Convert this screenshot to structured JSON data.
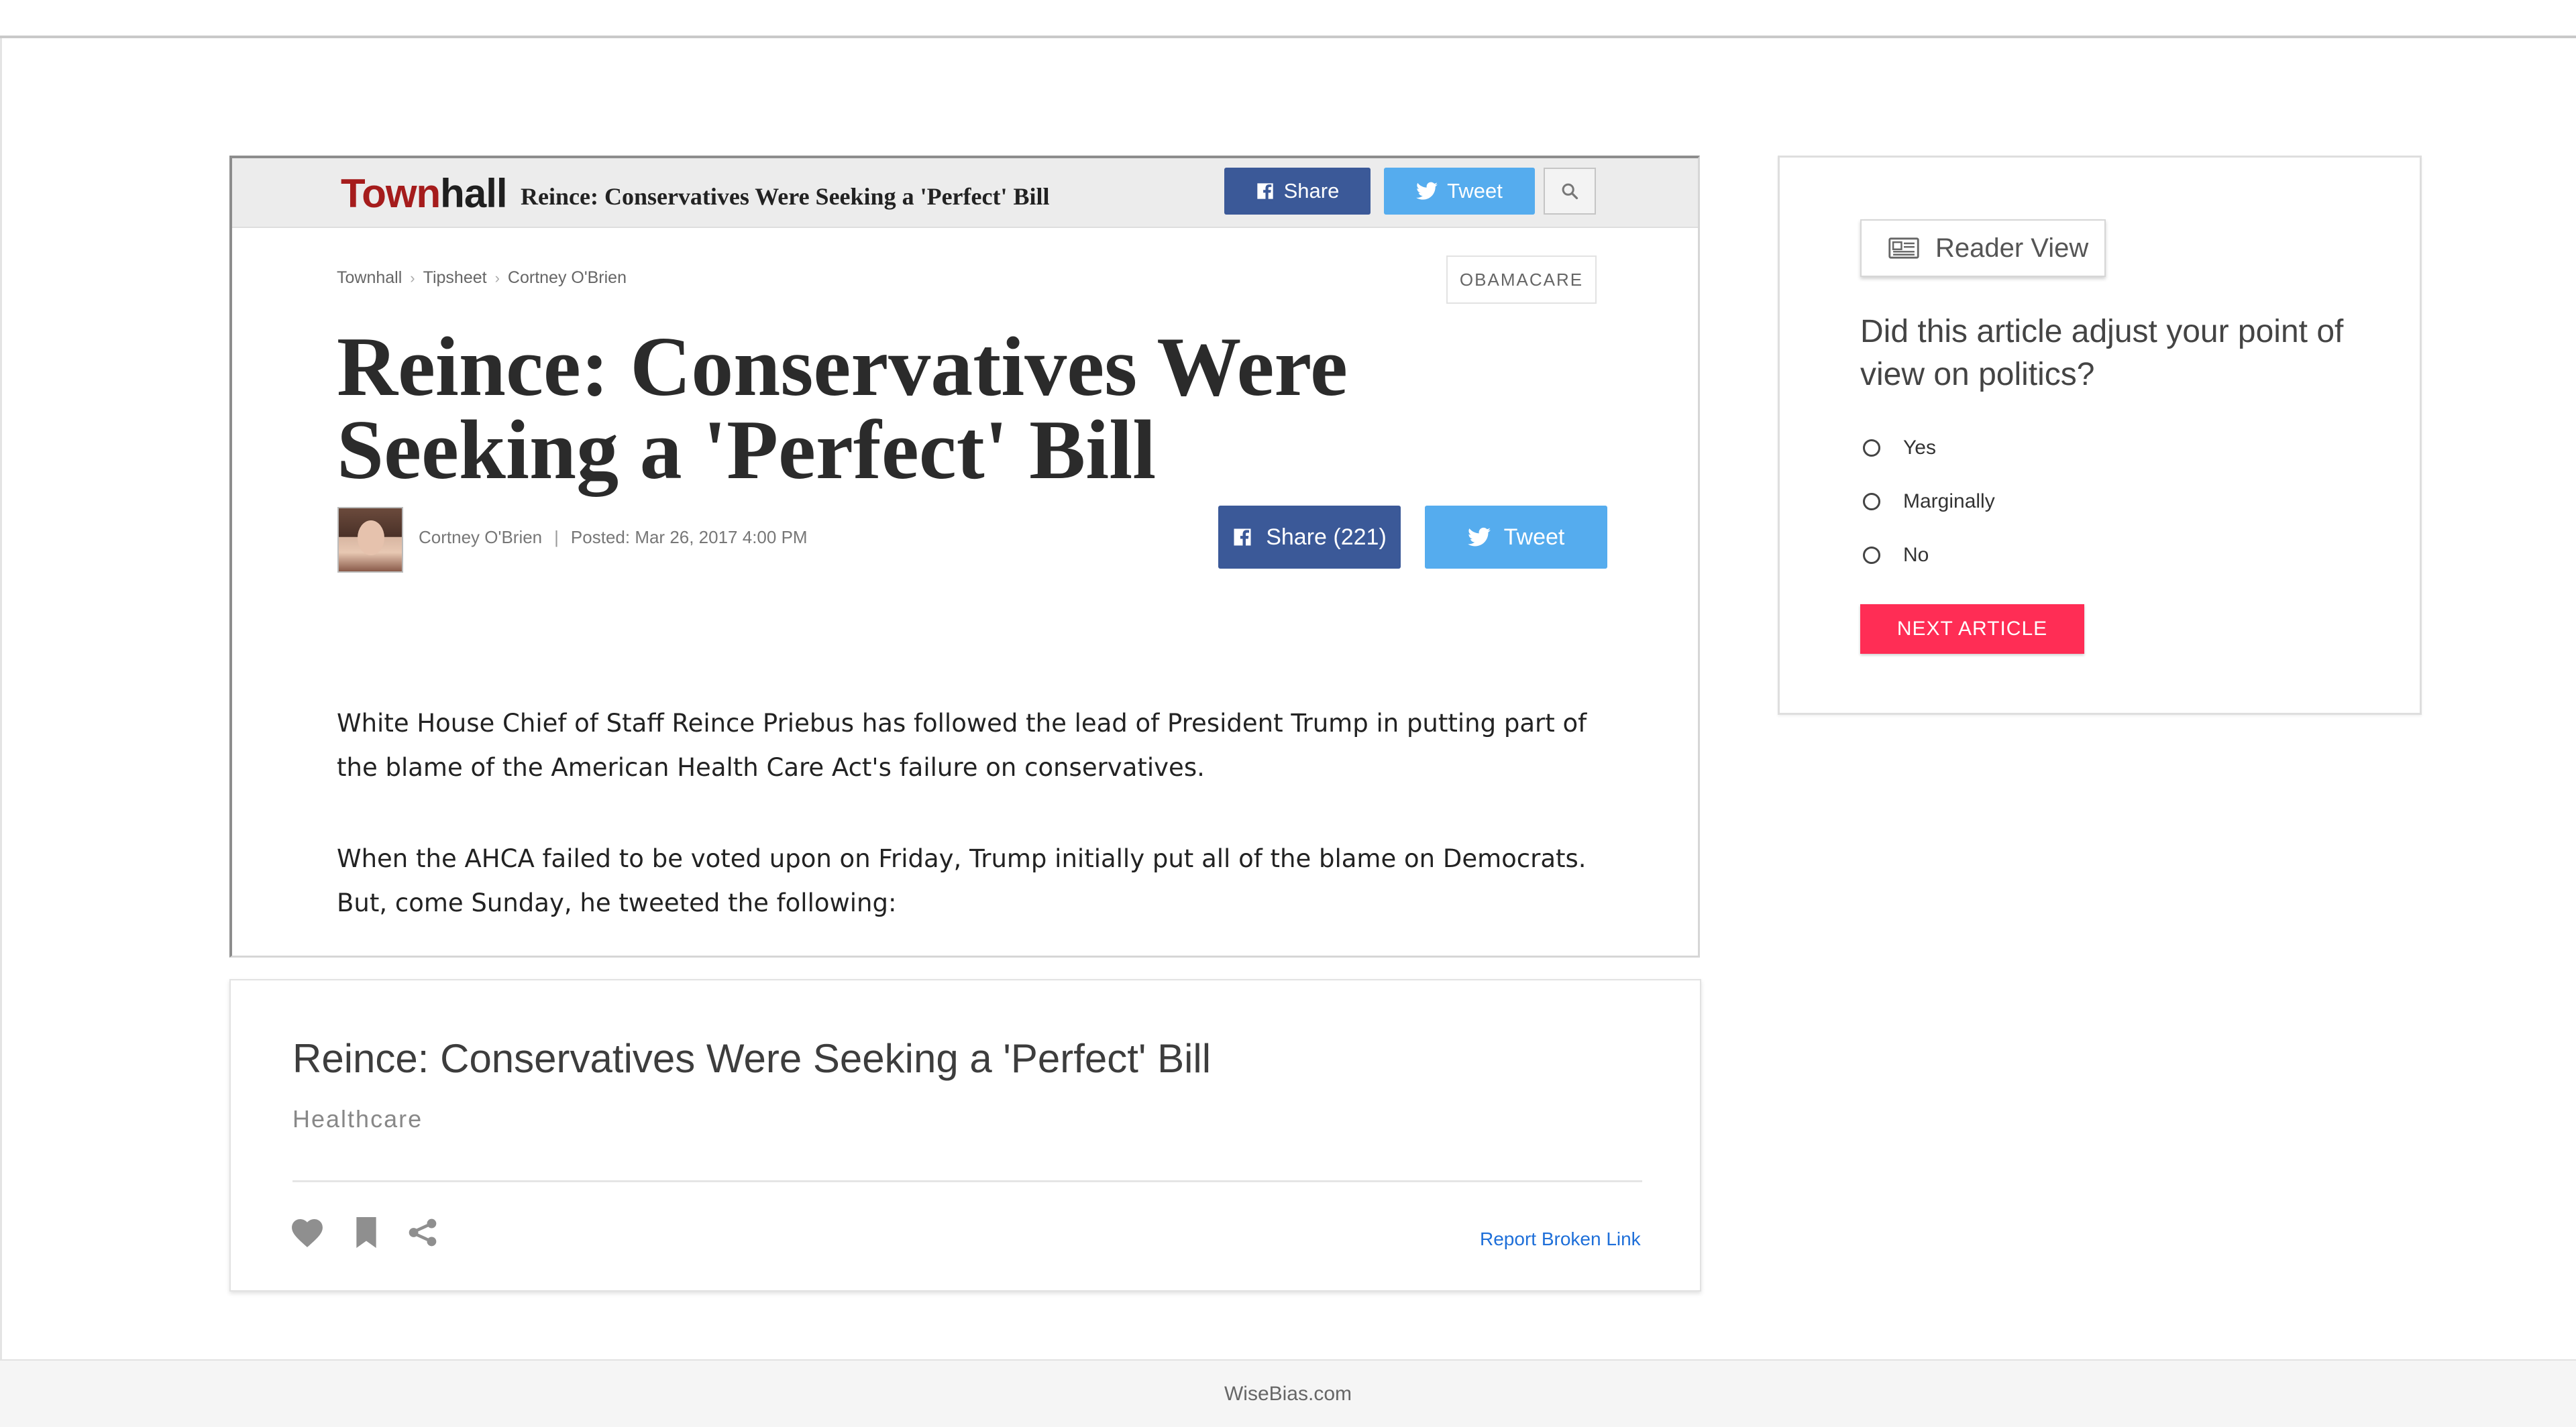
{
  "townhall": {
    "logo_town": "Town",
    "logo_hall": "hall",
    "header_title": "Reince: Conservatives Were Seeking a 'Perfect' Bill",
    "share_small": "Share",
    "tweet_small": "Tweet",
    "breadcrumbs": [
      "Townhall",
      "Tipsheet",
      "Cortney O'Brien"
    ],
    "tag": "OBAMACARE",
    "headline": "Reince: Conservatives Were Seeking a 'Perfect' Bill",
    "author": "Cortney O'Brien",
    "posted": "Posted: Mar 26, 2017 4:00 PM",
    "share_large": "Share (221)",
    "tweet_large": "Tweet",
    "paragraphs": [
      "White House Chief of Staff Reince Priebus has followed the lead of President Trump in putting part of the blame of the American Health Care Act's failure on conservatives.",
      "When the AHCA failed to be voted upon on Friday, Trump initially put all of the blame on Democrats. But, come Sunday, he tweeted the following:"
    ]
  },
  "card": {
    "title": "Reince: Conservatives Were Seeking a 'Perfect' Bill",
    "category": "Healthcare",
    "icons": [
      "heart-icon",
      "bookmark-icon",
      "share-icon"
    ],
    "report_link": "Report Broken Link"
  },
  "survey": {
    "reader_view": "Reader View",
    "question": "Did this article adjust your point of view on politics?",
    "options": [
      "Yes",
      "Marginally",
      "No"
    ],
    "next_button": "NEXT ARTICLE",
    "accent_color": "#ff2d55"
  },
  "footer": {
    "text": "WiseBias.com"
  }
}
